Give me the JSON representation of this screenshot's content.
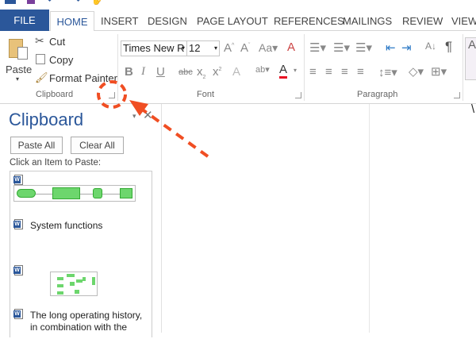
{
  "tabs": [
    "FILE",
    "HOME",
    "INSERT",
    "DESIGN",
    "PAGE LAYOUT",
    "REFERENCES",
    "MAILINGS",
    "REVIEW",
    "VIEW"
  ],
  "clipboard_group": {
    "paste": "Paste",
    "cut": "Cut",
    "copy": "Copy",
    "format_painter": "Format Painter",
    "label": "Clipboard"
  },
  "font_group": {
    "font_name": "Times New R",
    "font_size": "12",
    "label": "Font",
    "change_case": "Aa",
    "font_color": "#e81123"
  },
  "paragraph_group": {
    "label": "Paragraph"
  },
  "pane": {
    "title": "Clipboard",
    "paste_all": "Paste All",
    "clear_all": "Clear All",
    "instruction": "Click an Item to Paste:",
    "items": [
      "System functions",
      "The long operating history, in combination with the"
    ]
  },
  "annotation_color": "#f04e23",
  "file_tab_color": "#2b579a"
}
